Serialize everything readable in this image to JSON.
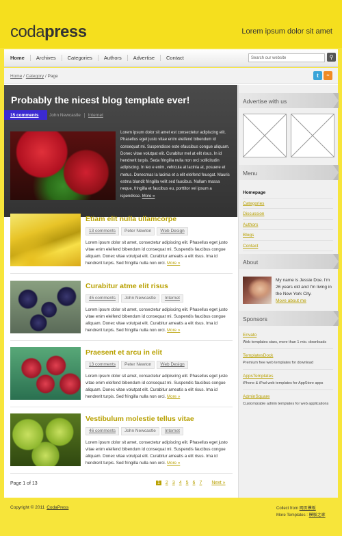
{
  "header": {
    "logo_light": "coda",
    "logo_bold": "press",
    "tagline": "Lorem ipsum dolor sit amet"
  },
  "nav": {
    "items": [
      "Home",
      "Archives",
      "Categories",
      "Authors",
      "Advertise",
      "Contact"
    ],
    "search_placeholder": "Search our website",
    "search_icon": "magnifier-icon"
  },
  "breadcrumb": {
    "home": "Home",
    "category": "Category",
    "current": "Page",
    "separator": "/"
  },
  "social": {
    "twitter": "t",
    "rss": "rss-icon"
  },
  "featured": {
    "title": "Probably the nicest blog template ever!",
    "comments": "15 comments",
    "author": "John Newcastle",
    "category": "Internet",
    "body": "Lorem ipsum dolor sit amet est consectetur adipiscing elit. Phasellus eget justo vitae enim eleifend bibendum id consequat mi. Suspendisse este efaucibus congue aliquam. Donec vitae volutpat elit. Curabitur mel at elit risus. In id hendrerit turpis. Seda fringilla nulla non orci sollicitudin adipiscing. In leo e enim, vehicula at lacinia at, posuere et metus. Donecmas la lacinia et a elit eleifend feusgat. Mauris estma blandit fringilla velit sed faucibus. Nullam massa neque, fringilla et faucibus eu, porttitor vel ipsum a ispendisse.",
    "more": "More »"
  },
  "posts": [
    {
      "title": "Etiam elit nulla ullamcorpe",
      "comments": "13 comments",
      "author": "Peter Newton",
      "category": "Web Design",
      "text": "Lorem ipsum dolor sit amet, consectetur adipiscing elit. Phasellus eget justo vitae enim eleifend bibendum id consequat mi. Suspendis faucibus congue aliquam. Donec vitae volutpat elit. Curabitur ameatis a elit risus. Ima id hendrerit turpis. Sed fringilla nulla non orci.",
      "more": "More »"
    },
    {
      "title": "Curabitur atme elit risus",
      "comments": "45 comments",
      "author": "John Newcastle",
      "category": "Internet",
      "text": "Lorem ipsum dolor sit amet, consectetur adipiscing elit. Phasellus eget justo vitae enim eleifend bibendum id consequat mi. Suspendis faucibus congue aliquam. Donec vitae volutpat elit. Curabitur ameatis a elit risus. Ima id hendrerit turpis. Sed fringilla nulla non orci.",
      "more": "More »"
    },
    {
      "title": "Praesent et arcu in elit",
      "comments": "13 comments",
      "author": "Peter Newton",
      "category": "Web Design",
      "text": "Lorem ipsum dolor sit amet, consectetur adipiscing elit. Phasellus eget justo vitae enim eleifend bibendum id consequat mi. Suspendis faucibus congue aliquam. Donec vitae volutpat elit. Curabitur ameatis a elit risus. Ima id hendrerit turpis. Sed fringilla nulla non orci.",
      "more": "More »"
    },
    {
      "title": "Vestibulum molestie tellus vitae",
      "comments": "46 comments",
      "author": "John Newcastle",
      "category": "Internet",
      "text": "Lorem ipsum dolor sit amet, consectetur adipiscing elit. Phasellus eget justo vitae enim eleifend bibendum id consequat mi. Suspendis faucibus congue aliquam. Donec vitae volutpat elit. Curabitur ameatis a elit risus. Ima id hendrerit turpis. Sed fringilla nulla non orci.",
      "more": "More »"
    }
  ],
  "pagination": {
    "label": "Page 1 of 13",
    "pages": [
      "1",
      "2",
      "3",
      "4",
      "5",
      "6",
      "7"
    ],
    "next": "Next »"
  },
  "sidebar": {
    "advertise_title": "Advertise with us",
    "menu_title": "Menu",
    "menu_items": [
      "Homepage",
      "Categories",
      "Discussion",
      "Authors",
      "Blogs",
      "Contact"
    ],
    "about_title": "About",
    "about_text": "My name is Jessie Doe. I'm 26 years old and I'm living in the New York City.",
    "about_link": "Move about me",
    "sponsors_title": "Sponsors",
    "sponsors": [
      {
        "name": "Envato",
        "desc": "Web templates stars, more than 1 mio. downloads"
      },
      {
        "name": "TemplatesDock",
        "desc": "Premium free web templates for download"
      },
      {
        "name": "AppsTemplates",
        "desc": "iPhone & iPad web templates for AppStore apps"
      },
      {
        "name": "AdminSquare",
        "desc": "Customizable admin templates for web applications"
      }
    ]
  },
  "footer": {
    "copyright": "Copyright © 2011",
    "brand": "CodaPress",
    "collect": "Collect from",
    "collect_link": "网页模板",
    "more": "More Templates",
    "more_link": "模板之家"
  },
  "colors": {
    "accent": "#b8a000",
    "background": "#f7e53a",
    "ribbon": "#3b2ad2"
  }
}
